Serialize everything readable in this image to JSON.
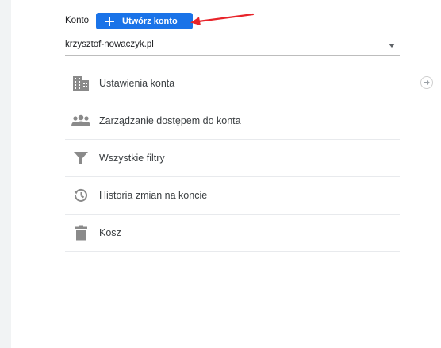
{
  "account": {
    "label": "Konto",
    "create_button_label": "Utwórz konto",
    "selected_account": "krzysztof-nowaczyk.pl"
  },
  "menu": {
    "items": [
      {
        "label": "Ustawienia konta",
        "icon": "building-icon"
      },
      {
        "label": "Zarządzanie dostępem do konta",
        "icon": "people-icon"
      },
      {
        "label": "Wszystkie filtry",
        "icon": "filter-icon"
      },
      {
        "label": "Historia zmian na koncie",
        "icon": "history-icon"
      },
      {
        "label": "Kosz",
        "icon": "trash-icon"
      }
    ]
  },
  "colors": {
    "accent": "#1a73e8",
    "icon": "#8a8a8a",
    "annotation_arrow": "#e8242a"
  }
}
